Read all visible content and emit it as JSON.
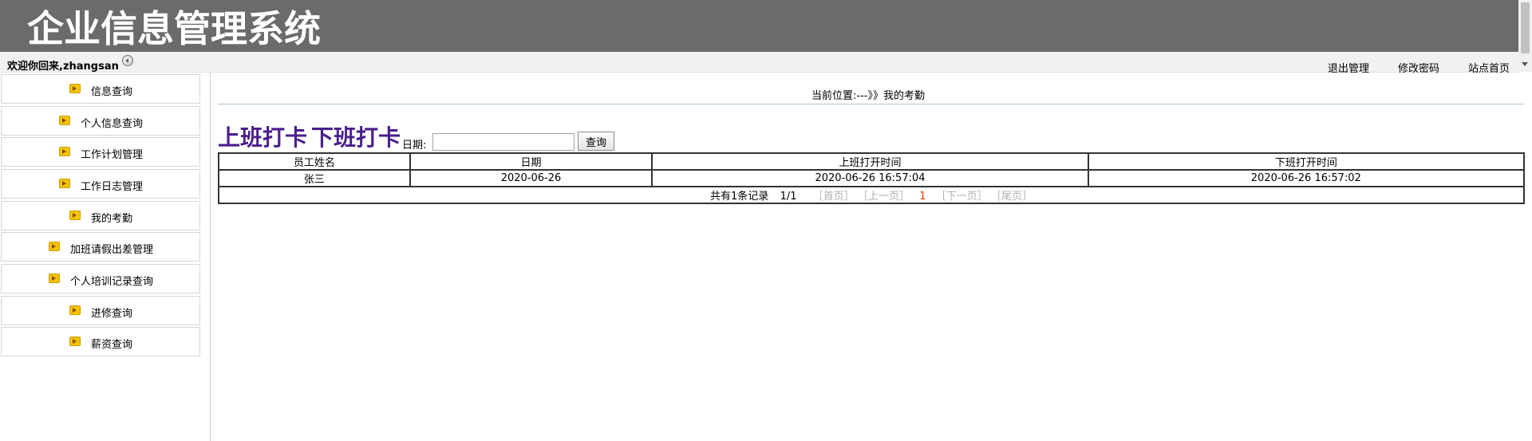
{
  "header": {
    "app_title": "企业信息管理系统"
  },
  "topbar": {
    "welcome": "欢迎你回来,zhangsan",
    "links": {
      "logout": "退出管理",
      "change_password": "修改密码",
      "site_home": "站点首页"
    }
  },
  "sidebar": {
    "items": [
      {
        "label": "信息查询"
      },
      {
        "label": "个人信息查询"
      },
      {
        "label": "工作计划管理"
      },
      {
        "label": "工作日志管理"
      },
      {
        "label": "我的考勤"
      },
      {
        "label": "加班请假出差管理"
      },
      {
        "label": "个人培训记录查询"
      },
      {
        "label": "进修查询"
      },
      {
        "label": "薪资查询"
      }
    ]
  },
  "main": {
    "breadcrumb": "当前位置:---》》我的考勤",
    "clock_in_label": "上班打卡",
    "clock_out_label": "下班打卡",
    "date_label": "日期:",
    "date_value": "",
    "search_label": "查询",
    "table": {
      "columns": [
        "员工姓名",
        "日期",
        "上班打开时间",
        "下班打开时间"
      ],
      "rows": [
        [
          "张三",
          "2020-06-26",
          "2020-06-26 16:57:04",
          "2020-06-26 16:57:02"
        ]
      ]
    },
    "pager": {
      "summary": "共有1条记录",
      "page_info": "1/1",
      "first": "［首页］",
      "prev": "［上一页］",
      "current": "1",
      "next": "［下一页］",
      "last": "［尾页］"
    }
  },
  "colors": {
    "header_bg": "#6b6b6b",
    "punch_text": "#4a1f8c",
    "pager_current": "#e03c00"
  }
}
